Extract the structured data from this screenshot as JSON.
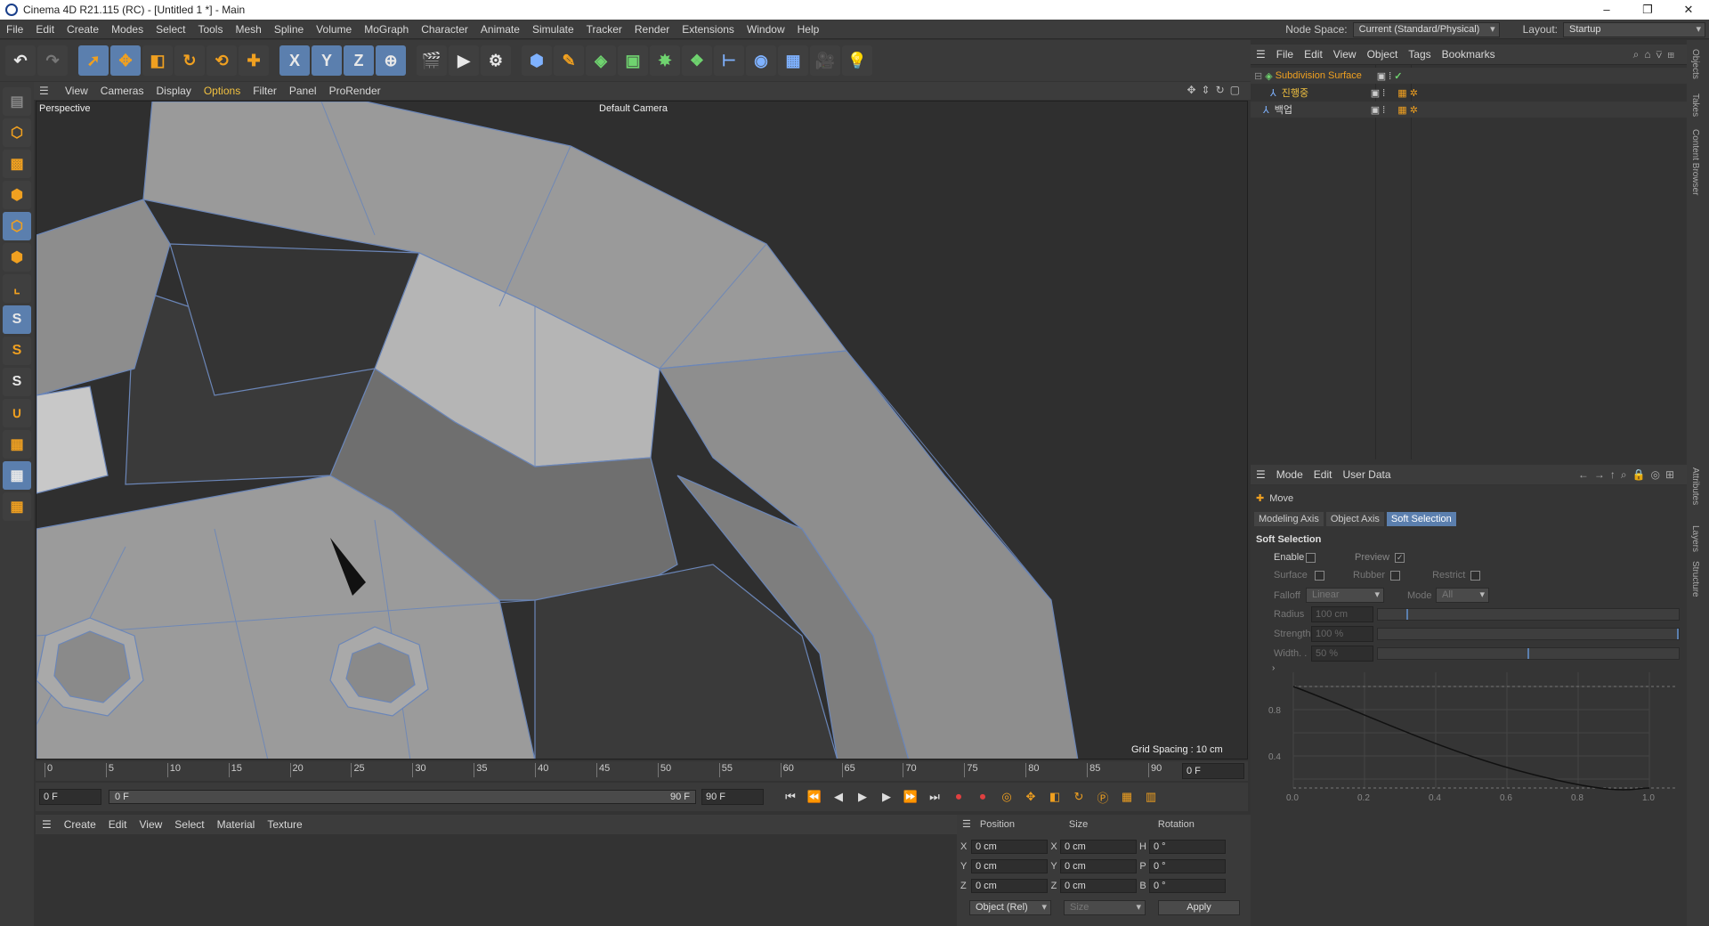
{
  "window": {
    "title": "Cinema 4D R21.115 (RC) - [Untitled 1 *] - Main",
    "minimize": "–",
    "restore": "❐",
    "close": "✕"
  },
  "menubar": {
    "items": [
      "File",
      "Edit",
      "Create",
      "Modes",
      "Select",
      "Tools",
      "Mesh",
      "Spline",
      "Volume",
      "MoGraph",
      "Character",
      "Animate",
      "Simulate",
      "Tracker",
      "Render",
      "Extensions",
      "Window",
      "Help"
    ],
    "node_space_label": "Node Space:",
    "node_space_value": "Current (Standard/Physical)",
    "layout_label": "Layout:",
    "layout_value": "Startup"
  },
  "toolbar": {
    "icons": [
      "undo-icon",
      "redo-icon",
      "live-selection-icon",
      "move-icon",
      "scale-icon",
      "rotate-icon",
      "recent-tool-icon",
      "coordinate-icon",
      "x-axis-icon",
      "y-axis-icon",
      "z-axis-icon",
      "world-coordinate-icon",
      "render-view-icon",
      "render-picture-viewer-icon",
      "render-settings-icon",
      "cube-icon",
      "pen-icon",
      "subdivision-icon",
      "extrude-icon",
      "cloner-icon",
      "array-icon",
      "deformer-icon",
      "sphere-tag-icon",
      "floor-icon",
      "camera-icon",
      "light-icon"
    ],
    "axis_x": "X",
    "axis_y": "Y",
    "axis_z": "Z"
  },
  "left_toolbar": {
    "icons": [
      "make-editable-icon",
      "model-mode-icon",
      "texture-mode-icon",
      "points-mode-icon",
      "edges-mode-icon",
      "polygons-mode-icon",
      "axis-mode-icon",
      "snap-icon",
      "snap-settings-icon",
      "snap-options-icon",
      "magnet-icon",
      "workplane-icon",
      "locked-workplane-icon",
      "quantize-icon"
    ],
    "snap_letter": "S"
  },
  "viewport": {
    "menu": [
      "View",
      "Cameras",
      "Display",
      "Options",
      "Filter",
      "Panel",
      "ProRender"
    ],
    "active_menu": "Options",
    "perspective_label": "Perspective",
    "camera_label": "Default Camera",
    "grid_spacing": "Grid Spacing : 10 cm"
  },
  "timeline": {
    "ticks": [
      "0",
      "5",
      "10",
      "15",
      "20",
      "25",
      "30",
      "35",
      "40",
      "45",
      "50",
      "55",
      "60",
      "65",
      "70",
      "75",
      "80",
      "85",
      "90"
    ],
    "current_frame": "0 F",
    "start_field": "0 F",
    "range_start": "0 F",
    "range_end": "90 F",
    "end_field": "90 F"
  },
  "material_manager": {
    "menu": [
      "Create",
      "Edit",
      "View",
      "Select",
      "Material",
      "Texture"
    ]
  },
  "coordinates": {
    "headers": [
      "Position",
      "Size",
      "Rotation"
    ],
    "rows": [
      {
        "pos_axis": "X",
        "pos": "0 cm",
        "size_axis": "X",
        "size": "0 cm",
        "rot_axis": "H",
        "rot": "0 °"
      },
      {
        "pos_axis": "Y",
        "pos": "0 cm",
        "size_axis": "Y",
        "size": "0 cm",
        "rot_axis": "P",
        "rot": "0 °"
      },
      {
        "pos_axis": "Z",
        "pos": "0 cm",
        "size_axis": "Z",
        "size": "0 cm",
        "rot_axis": "B",
        "rot": "0 °"
      }
    ],
    "mode_value": "Object (Rel)",
    "size_mode": "Size",
    "apply_label": "Apply"
  },
  "objects": {
    "menu": [
      "File",
      "Edit",
      "View",
      "Object",
      "Tags",
      "Bookmarks"
    ],
    "items": [
      {
        "name": "Subdivision Surface",
        "color": "#f0a020"
      },
      {
        "name": "진행중",
        "color": "#f0c040"
      },
      {
        "name": "백업",
        "color": "#d8d8d8"
      }
    ]
  },
  "attributes": {
    "menu": [
      "Mode",
      "Edit",
      "User Data"
    ],
    "tool_name": "Move",
    "tabs": [
      "Modeling Axis",
      "Object Axis",
      "Soft Selection"
    ],
    "active_tab": "Soft Selection",
    "section": "Soft Selection",
    "enable_label": "Enable",
    "preview_label": "Preview",
    "preview_checked": true,
    "surface_label": "Surface",
    "rubber_label": "Rubber",
    "restrict_label": "Restrict",
    "falloff_label": "Falloff",
    "falloff_value": "Linear",
    "mode_label": "Mode",
    "mode_value": "All",
    "radius_label": "Radius",
    "radius_value": "100 cm",
    "strength_label": "Strength",
    "strength_value": "100 %",
    "width_label": "Width. .",
    "width_value": "50 %",
    "graph_y": [
      "0.8",
      "0.4"
    ],
    "graph_x": [
      "0.0",
      "0.2",
      "0.4",
      "0.6",
      "0.8",
      "1.0"
    ]
  },
  "side_tabs": [
    "Objects",
    "Takes",
    "Content Browser",
    "Attributes",
    "Layers",
    "Structure"
  ]
}
